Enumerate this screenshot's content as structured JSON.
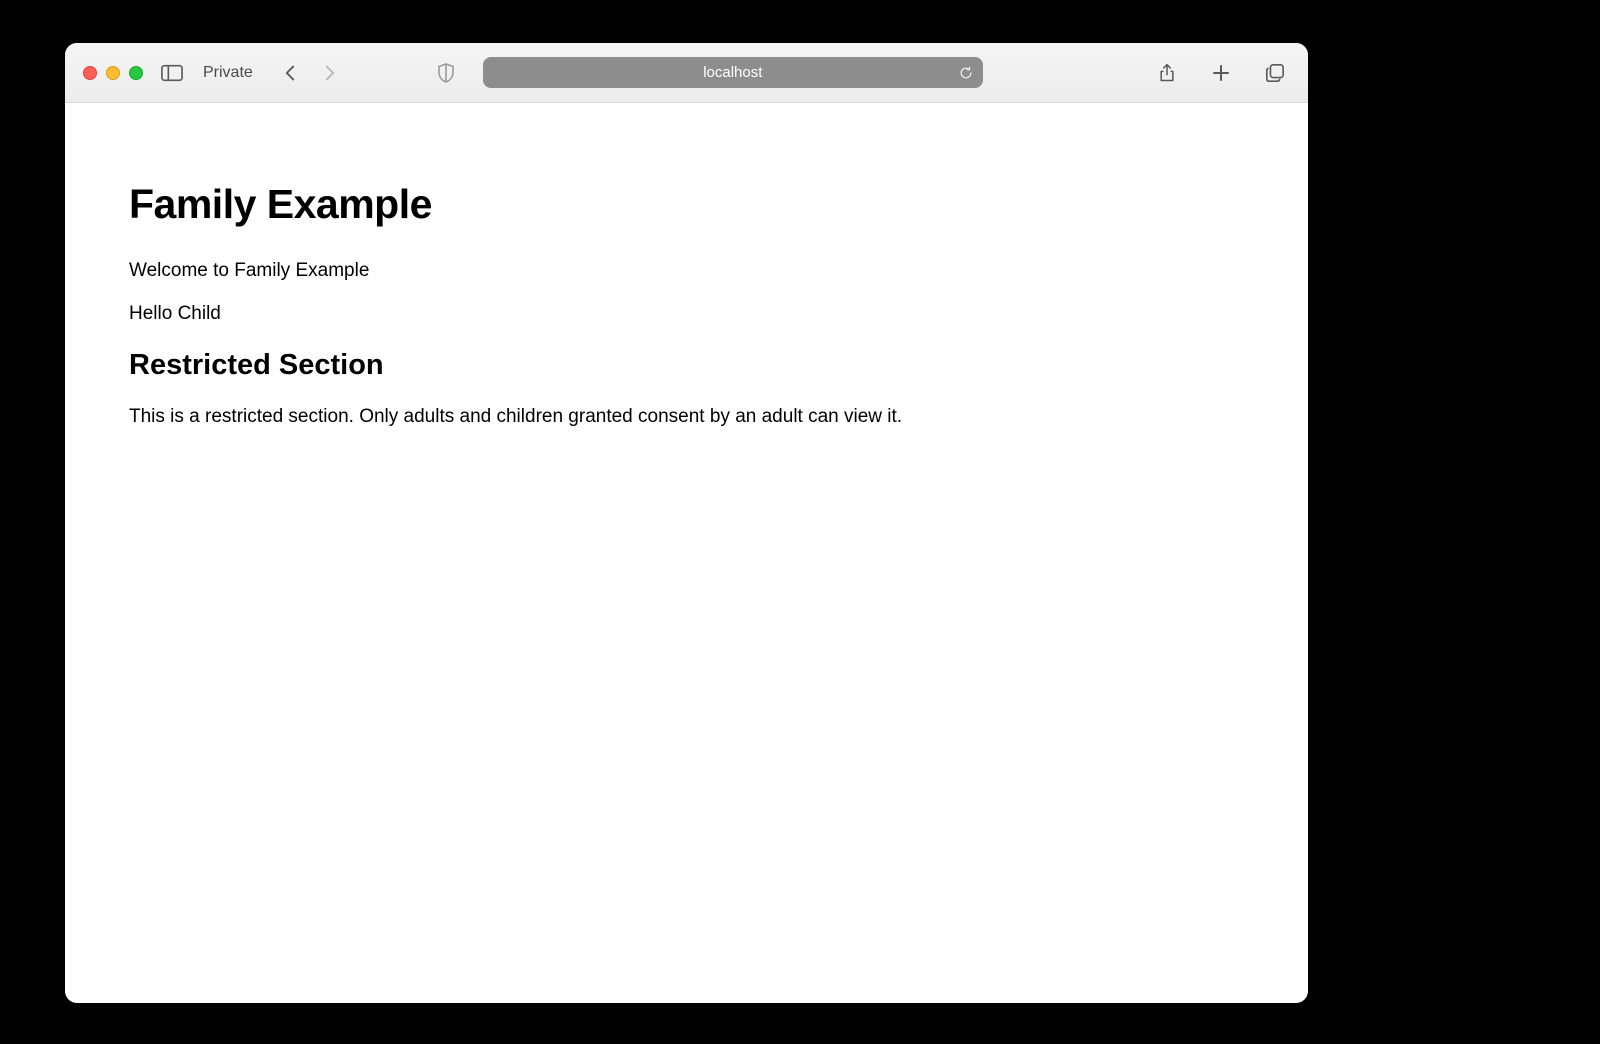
{
  "browser": {
    "private_label": "Private",
    "address": "localhost"
  },
  "page": {
    "h1": "Family Example",
    "p1": "Welcome to Family Example",
    "p2": "Hello Child",
    "h2": "Restricted Section",
    "p3": "This is a restricted section. Only adults and children granted consent by an adult can view it."
  }
}
